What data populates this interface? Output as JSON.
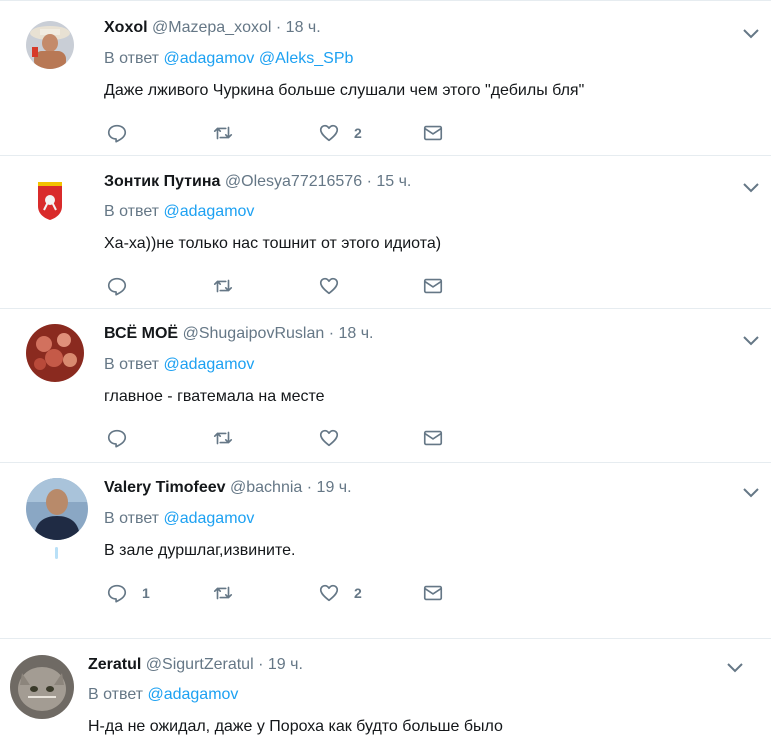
{
  "tweets": [
    {
      "fullname": "Xoxol",
      "username": "@Mazepa_xoxol",
      "time": "· 18 ч.",
      "reply_prefix": "В ответ",
      "mentions": [
        "@adagamov",
        "@Aleks_SPb"
      ],
      "text": "Даже лживого Чуркина больше слушали чем этого \"дебилы бля\"",
      "reply_count": "",
      "retweet_count": "",
      "like_count": "2"
    },
    {
      "fullname": "Зонтик Путина",
      "username": "@Olesya77216576",
      "time": "· 15 ч.",
      "reply_prefix": "В ответ",
      "mentions": [
        "@adagamov"
      ],
      "text": "Ха-ха))не только нас тошнит от этого идиота)",
      "reply_count": "",
      "retweet_count": "",
      "like_count": ""
    },
    {
      "fullname": "ВСЁ МОЁ",
      "username": "@ShugaipovRuslan",
      "time": "· 18 ч.",
      "reply_prefix": "В ответ",
      "mentions": [
        "@adagamov"
      ],
      "text": "главное - гватемала на месте",
      "reply_count": "",
      "retweet_count": "",
      "like_count": ""
    },
    {
      "fullname": "Valery Timofeev",
      "username": "@bachnia",
      "time": "· 19 ч.",
      "reply_prefix": "В ответ",
      "mentions": [
        "@adagamov"
      ],
      "text": "В зале дуршлаг,извините.",
      "reply_count": "1",
      "retweet_count": "",
      "like_count": "2"
    },
    {
      "fullname": "Zeratul",
      "username": "@SigurtZeratul",
      "time": "· 19 ч.",
      "reply_prefix": "В ответ",
      "mentions": [
        "@adagamov"
      ],
      "text": "Н-да не ожидал, даже у Пороха как будто больше было",
      "reply_count": "",
      "retweet_count": "",
      "like_count": ""
    }
  ],
  "icons": {
    "reply": "reply-icon",
    "retweet": "retweet-icon",
    "like": "heart-icon",
    "dm": "envelope-icon",
    "menu": "chevron-down-icon"
  },
  "colors": {
    "link": "#1da1f2",
    "muted": "#657786",
    "text": "#14171a",
    "divider": "#e6ecf0"
  }
}
